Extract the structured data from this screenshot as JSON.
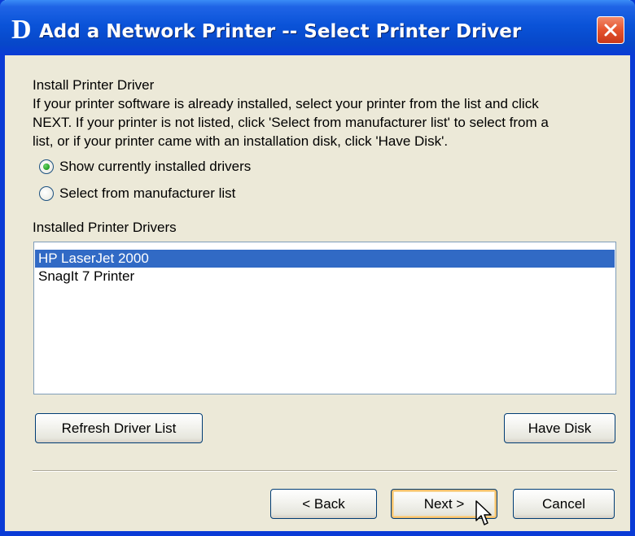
{
  "window": {
    "logo_text": "D",
    "title": "Add a Network Printer -- Select Printer Driver",
    "close_icon": "close-x-icon",
    "colors": {
      "titlebar": "#0a53d8",
      "close_button": "#e5532d",
      "selection": "#316ac5",
      "face": "#ece9d8"
    }
  },
  "instructions": {
    "heading": "Install Printer Driver",
    "lines": [
      "If your printer software is already installed, select your printer from the list and click",
      "NEXT. If your printer is not listed, click 'Select from manufacturer list' to select from a",
      "list, or if your printer came with an installation disk, click 'Have Disk'."
    ]
  },
  "driver_source": {
    "options": [
      {
        "label": "Show currently installed drivers",
        "selected": true
      },
      {
        "label": "Select from manufacturer list",
        "selected": false
      }
    ]
  },
  "drivers": {
    "label": "Installed Printer Drivers",
    "items": [
      {
        "name": "HP LaserJet 2000",
        "selected": true
      },
      {
        "name": "SnagIt 7 Printer",
        "selected": false
      }
    ]
  },
  "buttons": {
    "refresh": "Refresh Driver List",
    "have_disk": "Have Disk",
    "back": "< Back",
    "next": "Next >",
    "cancel": "Cancel"
  }
}
